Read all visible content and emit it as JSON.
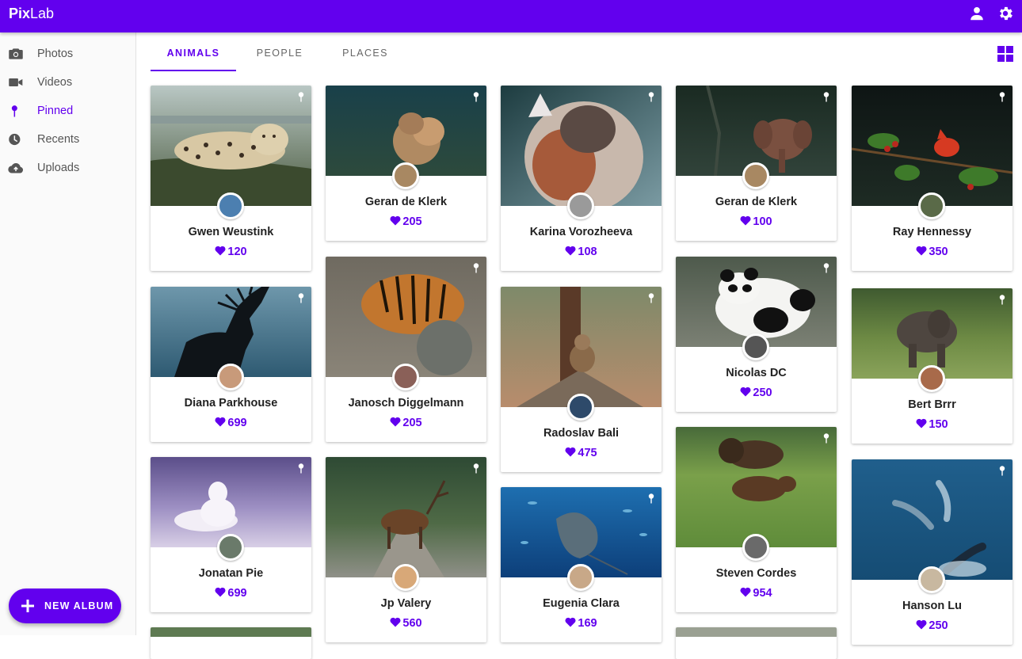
{
  "app": {
    "brand_bold": "Pix",
    "brand_light": "Lab"
  },
  "header": {
    "icons": [
      "account-icon",
      "settings-icon"
    ]
  },
  "sidebar": {
    "items": [
      {
        "label": "Photos",
        "icon": "camera-icon",
        "active": false
      },
      {
        "label": "Videos",
        "icon": "videocam-icon",
        "active": false
      },
      {
        "label": "Pinned",
        "icon": "pin-icon",
        "active": true
      },
      {
        "label": "Recents",
        "icon": "clock-icon",
        "active": false
      },
      {
        "label": "Uploads",
        "icon": "cloud-upload-icon",
        "active": false
      }
    ],
    "new_album_label": "NEW ALBUM"
  },
  "tabs": [
    {
      "label": "ANIMALS",
      "active": true
    },
    {
      "label": "PEOPLE",
      "active": false
    },
    {
      "label": "PLACES",
      "active": false
    }
  ],
  "view_toggle": {
    "icon": "grid-view-icon"
  },
  "colors": {
    "primary": "#6200ee",
    "sidebar_bg": "#fafafa"
  },
  "columns": [
    [
      {
        "subject": "leopard",
        "owner": "Gwen Weustink",
        "likes": "120"
      },
      {
        "subject": "deer silhouette",
        "owner": "Diana Parkhouse",
        "likes": "699"
      },
      {
        "subject": "arctic fox",
        "owner": "Jonatan Pie",
        "likes": "699"
      }
    ],
    [
      {
        "subject": "lion cubs",
        "owner": "Geran de Klerk",
        "likes": "205"
      },
      {
        "subject": "tiger",
        "owner": "Janosch Diggelmann",
        "likes": "205"
      },
      {
        "subject": "elk on road",
        "owner": "Jp Valery",
        "likes": "560"
      }
    ],
    [
      {
        "subject": "cat with butterfly",
        "owner": "Karina Vorozheeva",
        "likes": "108"
      },
      {
        "subject": "monkey",
        "owner": "Radoslav Bali",
        "likes": "475"
      },
      {
        "subject": "stingray",
        "owner": "Eugenia Clara",
        "likes": "169"
      }
    ],
    [
      {
        "subject": "elephant",
        "owner": "Geran de Klerk",
        "likes": "100"
      },
      {
        "subject": "panda",
        "owner": "Nicolas DC",
        "likes": "250"
      },
      {
        "subject": "bison and bear",
        "owner": "Steven Cordes",
        "likes": "954"
      }
    ],
    [
      {
        "subject": "cardinal bird",
        "owner": "Ray Hennessy",
        "likes": "350"
      },
      {
        "subject": "baby elephant",
        "owner": "Bert Brrr",
        "likes": "150"
      },
      {
        "subject": "dolphins",
        "owner": "Hanson Lu",
        "likes": "250"
      }
    ]
  ]
}
